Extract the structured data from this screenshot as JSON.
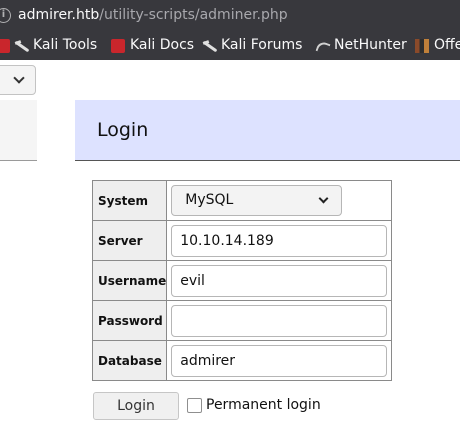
{
  "browser": {
    "url_host": "admirer.htb",
    "url_path": "/utility-scripts/adminer.php",
    "bookmarks": [
      {
        "label": "Kali Tools",
        "icon": "kali-dragon-icon"
      },
      {
        "label": "Kali Docs",
        "icon": "kali-docs-icon"
      },
      {
        "label": "Kali Forums",
        "icon": "kali-dragon-icon"
      },
      {
        "label": "NetHunter",
        "icon": "nethunter-icon"
      },
      {
        "label": "Offe",
        "icon": "offsec-icon"
      }
    ]
  },
  "header": {
    "title": "Login"
  },
  "form": {
    "system_label": "System",
    "system_value": "MySQL",
    "server_label": "Server",
    "server_value": "10.10.14.189",
    "username_label": "Username",
    "username_value": "evil",
    "password_label": "Password",
    "password_value": "",
    "database_label": "Database",
    "database_value": "admirer",
    "login_label": "Login",
    "permanent_label": "Permanent login"
  }
}
